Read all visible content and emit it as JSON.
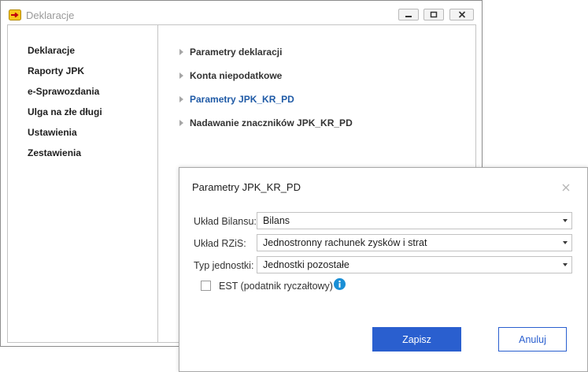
{
  "window": {
    "title": "Deklaracje"
  },
  "sidebar": {
    "items": [
      {
        "label": "Deklaracje"
      },
      {
        "label": "Raporty JPK"
      },
      {
        "label": "e-Sprawozdania"
      },
      {
        "label": "Ulga na złe długi"
      },
      {
        "label": "Ustawienia"
      },
      {
        "label": "Zestawienia"
      }
    ]
  },
  "links": [
    {
      "label": "Parametry deklaracji",
      "active": false
    },
    {
      "label": "Konta niepodatkowe",
      "active": false
    },
    {
      "label": "Parametry JPK_KR_PD",
      "active": true
    },
    {
      "label": "Nadawanie znaczników JPK_KR_PD",
      "active": false
    }
  ],
  "dialog": {
    "title": "Parametry JPK_KR_PD",
    "fields": [
      {
        "label": "Układ Bilansu:",
        "value": "Bilans"
      },
      {
        "label": "Układ RZiS:",
        "value": "Jednostronny rachunek zysków i strat"
      },
      {
        "label": "Typ jednostki:",
        "value": "Jednostki pozostałe"
      }
    ],
    "checkbox": {
      "label": "EST (podatnik ryczałtowy)",
      "checked": false
    },
    "save_label": "Zapisz",
    "cancel_label": "Anuluj"
  },
  "colors": {
    "accent": "#2a5fcf",
    "active_link": "#1f5aa6",
    "info": "#1a8fd6"
  }
}
